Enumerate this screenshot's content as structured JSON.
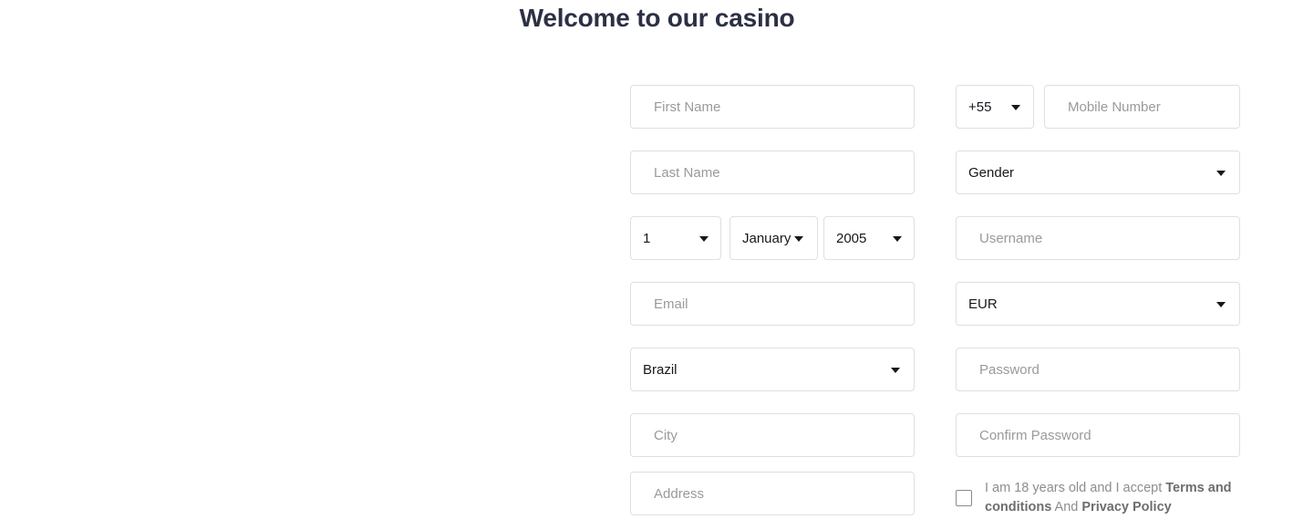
{
  "page": {
    "title": "Welcome to our casino",
    "background": "#ffffff",
    "title_color": "#2b3044",
    "border_color": "#dfdfdf",
    "placeholder_color": "#9a9a9a",
    "value_color": "#16181d"
  },
  "form": {
    "first_name": {
      "placeholder": "First Name",
      "value": ""
    },
    "last_name": {
      "placeholder": "Last Name",
      "value": ""
    },
    "dob": {
      "day": {
        "value": "1"
      },
      "month": {
        "value": "January"
      },
      "year": {
        "value": "2005"
      }
    },
    "email": {
      "placeholder": "Email",
      "value": ""
    },
    "country": {
      "value": "Brazil"
    },
    "city": {
      "placeholder": "City",
      "value": ""
    },
    "address": {
      "placeholder": "Address",
      "value": ""
    },
    "country_code": {
      "value": "+55"
    },
    "mobile_number": {
      "placeholder": "Mobile Number",
      "value": ""
    },
    "gender": {
      "value": "Gender"
    },
    "username": {
      "placeholder": "Username",
      "value": ""
    },
    "currency": {
      "value": "EUR"
    },
    "password": {
      "placeholder": "Password",
      "value": ""
    },
    "confirm_password": {
      "placeholder": "Confirm Password",
      "value": ""
    }
  },
  "terms": {
    "checked": false,
    "lead": "I am 18 years old and I accept ",
    "terms_link": "Terms and conditions",
    "conjunction": " And ",
    "privacy_link": "Privacy Policy"
  }
}
